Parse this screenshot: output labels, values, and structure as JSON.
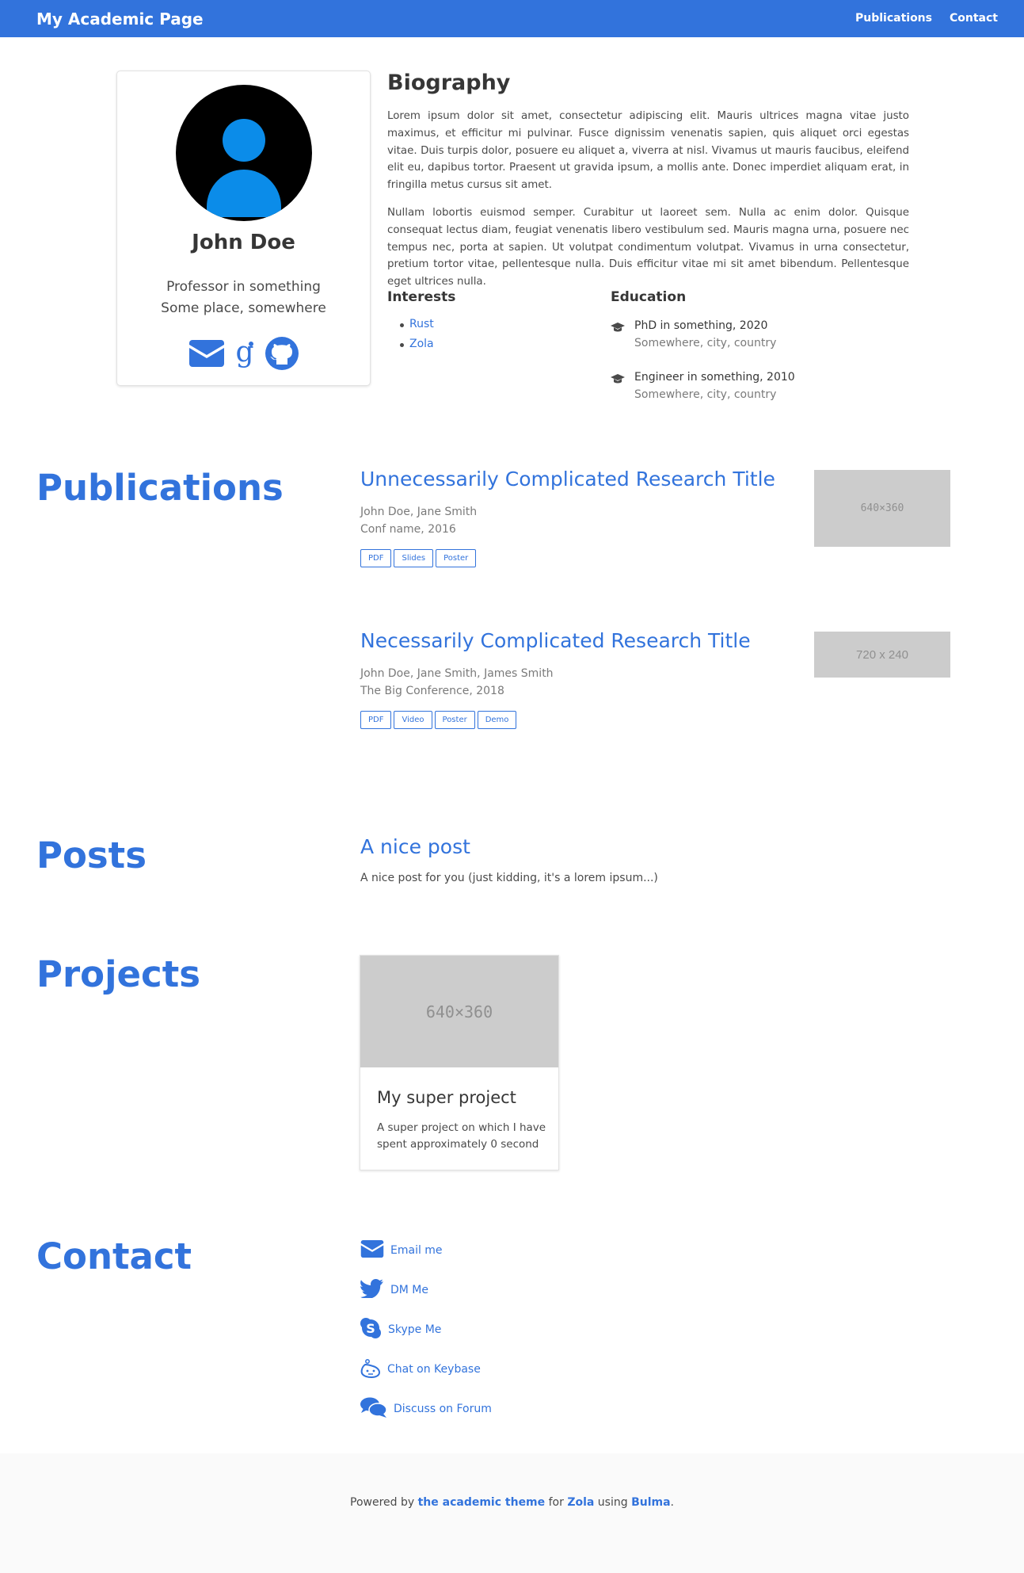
{
  "navbar": {
    "brand": "My Academic Page",
    "links": [
      "Publications",
      "Contact"
    ]
  },
  "profile": {
    "name": "John Doe",
    "title": "Professor in something",
    "location": "Some place, somewhere",
    "avatar_icon": "user-icon",
    "socials": [
      "envelope-icon",
      "google-scholar-icon",
      "github-icon"
    ]
  },
  "biography": {
    "title": "Biography",
    "paragraphs": [
      "Lorem ipsum dolor sit amet, consectetur adipiscing elit. Mauris ultrices magna vitae justo maximus, et efficitur mi pulvinar. Fusce dignissim venenatis sapien, quis aliquet orci egestas vitae. Duis turpis dolor, posuere eu aliquet a, viverra at nisl. Vivamus ut mauris faucibus, eleifend elit eu, dapibus tortor. Praesent ut gravida ipsum, a mollis ante. Donec imperdiet aliquam erat, in fringilla metus cursus sit amet.",
      "Nullam lobortis euismod semper. Curabitur ut laoreet sem. Nulla ac enim dolor. Quisque consequat lectus diam, feugiat venenatis libero vestibulum sed. Mauris magna urna, posuere nec tempus nec, porta at sapien. Ut volutpat condimentum volutpat. Vivamus in urna consectetur, pretium tortor vitae, pellentesque nulla. Duis efficitur vitae mi sit amet bibendum. Pellentesque eget ultrices nulla."
    ],
    "interests_title": "Interests",
    "interests": [
      "Rust",
      "Zola"
    ],
    "education_title": "Education",
    "education": [
      {
        "degree": "PhD in something, 2020",
        "place": "Somewhere, city, country"
      },
      {
        "degree": "Engineer in something, 2010",
        "place": "Somewhere, city, country"
      }
    ]
  },
  "publications": {
    "heading": "Publications",
    "items": [
      {
        "title": "Unnecessarily Complicated Research Title",
        "authors": "John Doe, Jane Smith",
        "venue": "Conf name, 2016",
        "links": [
          "PDF",
          "Slides",
          "Poster"
        ],
        "thumb_label": "640×360"
      },
      {
        "title": "Necessarily Complicated Research Title",
        "authors": "John Doe, Jane Smith, James Smith",
        "venue": "The Big Conference, 2018",
        "links": [
          "PDF",
          "Video",
          "Poster",
          "Demo"
        ],
        "thumb_label": "720 x 240"
      }
    ]
  },
  "posts": {
    "heading": "Posts",
    "items": [
      {
        "title": "A nice post",
        "summary": "A nice post for you (just kidding, it's a lorem ipsum...)"
      }
    ]
  },
  "projects": {
    "heading": "Projects",
    "items": [
      {
        "title": "My super project",
        "description": "A super project on which I have spent approximately 0 second",
        "thumb_label": "640×360"
      }
    ]
  },
  "contact": {
    "heading": "Contact",
    "items": [
      {
        "icon": "envelope-icon",
        "label": "Email me"
      },
      {
        "icon": "twitter-icon",
        "label": "DM Me"
      },
      {
        "icon": "skype-icon",
        "label": "Skype Me"
      },
      {
        "icon": "keybase-icon",
        "label": "Chat on Keybase"
      },
      {
        "icon": "comments-icon",
        "label": "Discuss on Forum"
      }
    ]
  },
  "footer": {
    "prefix": "Powered by",
    "theme_link": "the academic theme",
    "for": "for",
    "zola_link": "Zola",
    "using": "using",
    "bulma_link": "Bulma",
    "suffix": "."
  },
  "colors": {
    "primary": "#3273dc",
    "avatar_blue": "#0b8ce9",
    "placeholder_gray": "#cccccc",
    "footer_bg": "#fafafa"
  }
}
